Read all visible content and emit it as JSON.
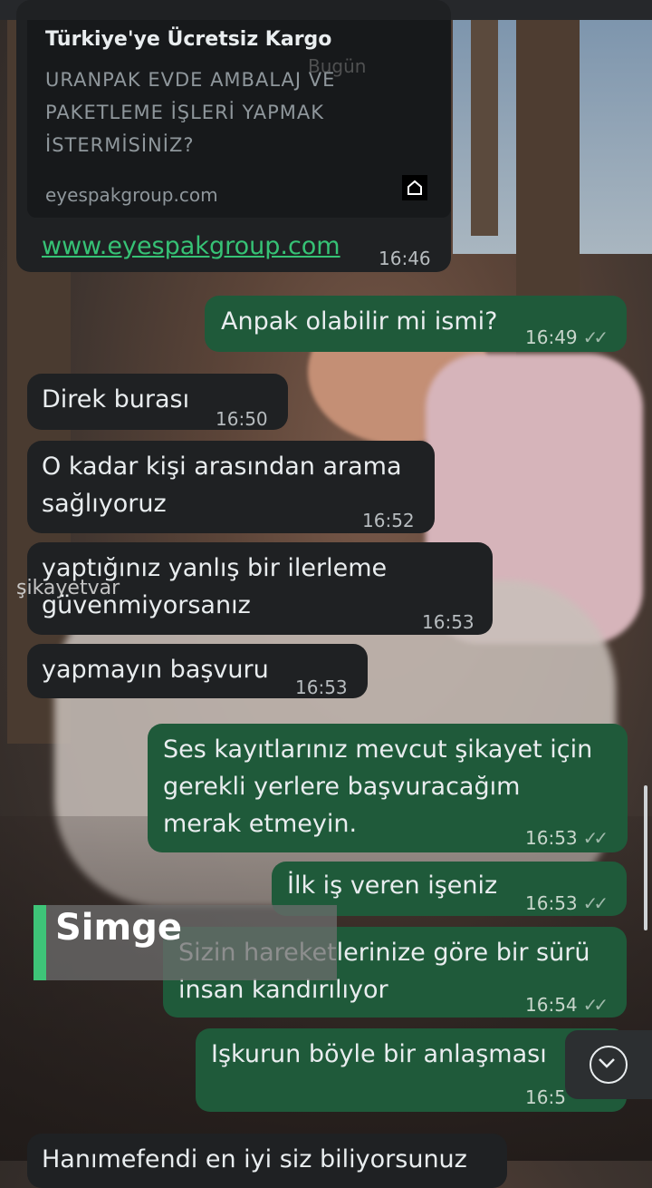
{
  "link_preview": {
    "title": "Türkiye'ye Ücretsiz Kargo",
    "description": "URANPAK EVDE AMBALAJ VE PAKETLEME İŞLERİ YAPMAK İSTERMİSİNİZ?",
    "domain": "eyespakgroup.com",
    "url": "www.eyespakgroup.com",
    "time": "16:46",
    "day_chip": "Bugün"
  },
  "messages": [
    {
      "dir": "out",
      "text": "Anpak olabilir mi ismi?",
      "time": "16:49",
      "read": true
    },
    {
      "dir": "in",
      "text": "Direk burası",
      "time": "16:50"
    },
    {
      "dir": "in",
      "text": "O kadar kişi arasından arama sağlıyoruz",
      "line1": "O kadar kişi arasından arama",
      "line2": "sağlıyoruz",
      "time": "16:52"
    },
    {
      "dir": "in",
      "line1": "yaptığınız yanlış bir ilerleme",
      "line2": "güvenmiyorsanız",
      "time": "16:53"
    },
    {
      "dir": "in",
      "text": "yapmayın başvuru",
      "time": "16:53"
    },
    {
      "dir": "out",
      "line1": "Ses kayıtlarınız mevcut şikayet için",
      "line2": "gerekli yerlere başvuracağım",
      "line3": "merak etmeyin.",
      "time": "16:53",
      "read": true
    },
    {
      "dir": "out",
      "text": "İlk iş veren işeniz",
      "time": "16:53",
      "read": true
    },
    {
      "dir": "out",
      "line1": "Sizin hareketlerinize göre bir sürü",
      "line2": "insan kandırılıyor",
      "time": "16:54",
      "read": true
    },
    {
      "dir": "out",
      "text": "Işkurun böyle bir anlaşması",
      "time": "16:5"
    },
    {
      "dir": "in",
      "text": "Hanımefendi en iyi siz biliyorsunuz"
    }
  ],
  "watermark": "şikayetvar",
  "name_tag": "Simge",
  "ticks_symbol": "✓✓",
  "icons": {
    "scroll": "chevron-down-icon",
    "card": "home-icon"
  }
}
